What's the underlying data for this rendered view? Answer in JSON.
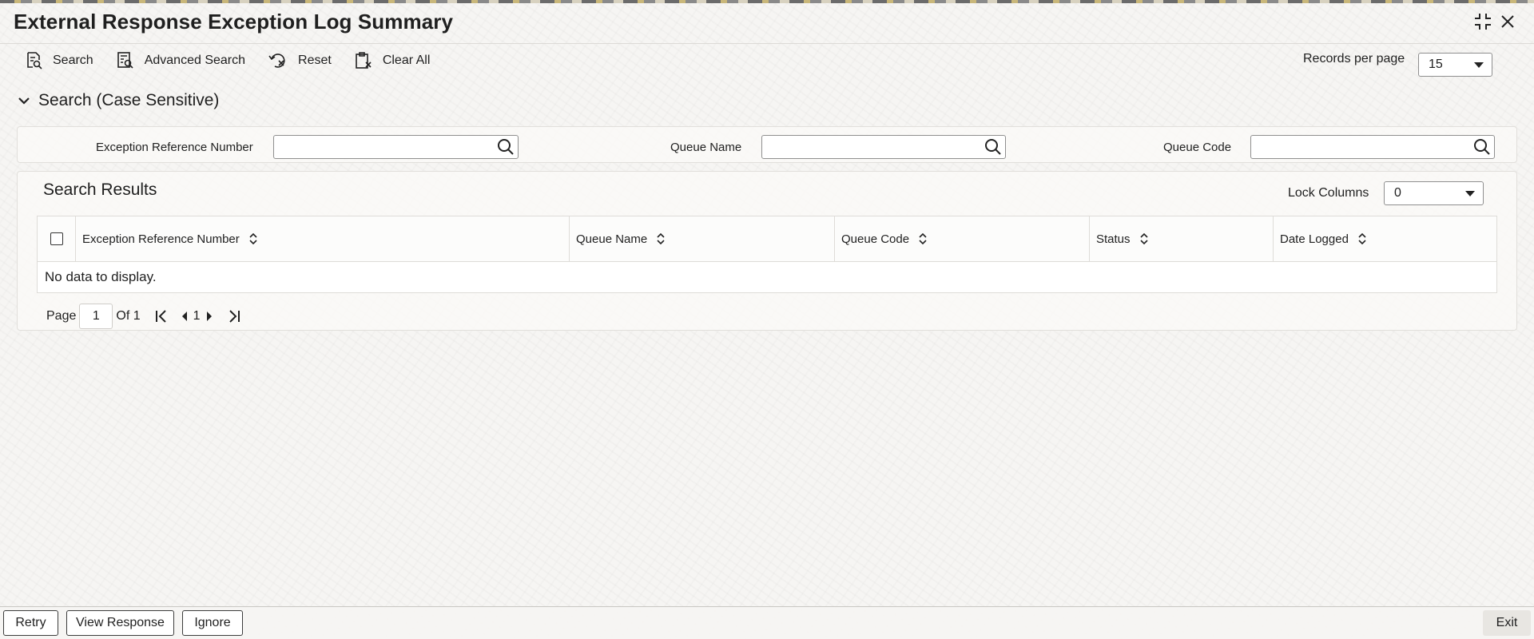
{
  "window": {
    "title": "External Response Exception Log Summary"
  },
  "toolbar": {
    "search_label": "Search",
    "advanced_search_label": "Advanced Search",
    "reset_label": "Reset",
    "clear_all_label": "Clear All",
    "records_per_page_label": "Records per page",
    "records_per_page_value": "15"
  },
  "search_section": {
    "header": "Search (Case Sensitive)",
    "fields": [
      {
        "label": "Exception Reference Number",
        "value": "",
        "placeholder": ""
      },
      {
        "label": "Queue Name",
        "value": "",
        "placeholder": ""
      },
      {
        "label": "Queue Code",
        "value": "",
        "placeholder": ""
      }
    ]
  },
  "results": {
    "title": "Search Results",
    "lock_columns_label": "Lock Columns",
    "lock_columns_value": "0",
    "columns": [
      "Exception Reference Number",
      "Queue Name",
      "Queue Code",
      "Status",
      "Date Logged"
    ],
    "rows": [],
    "empty_message": "No data to display."
  },
  "pagination": {
    "page_label": "Page",
    "current_page": "1",
    "of_label": "Of 1",
    "page_number_display": "1"
  },
  "footer": {
    "retry_label": "Retry",
    "view_response_label": "View Response",
    "ignore_label": "Ignore",
    "exit_label": "Exit"
  }
}
